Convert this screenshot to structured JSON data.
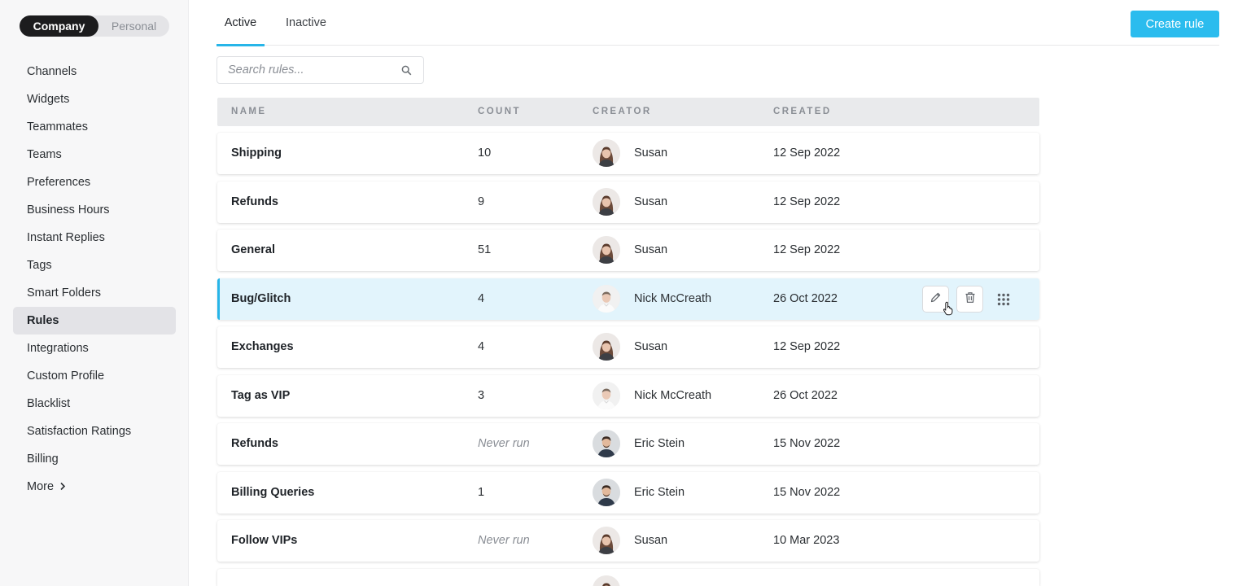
{
  "account_toggle": {
    "company": "Company",
    "personal": "Personal",
    "selected": "Company"
  },
  "sidebar": {
    "items": [
      {
        "label": "Channels"
      },
      {
        "label": "Widgets"
      },
      {
        "label": "Teammates"
      },
      {
        "label": "Teams"
      },
      {
        "label": "Preferences"
      },
      {
        "label": "Business Hours"
      },
      {
        "label": "Instant Replies"
      },
      {
        "label": "Tags"
      },
      {
        "label": "Smart Folders"
      },
      {
        "label": "Rules",
        "active": true
      },
      {
        "label": "Integrations"
      },
      {
        "label": "Custom Profile"
      },
      {
        "label": "Blacklist"
      },
      {
        "label": "Satisfaction Ratings"
      },
      {
        "label": "Billing"
      },
      {
        "label": "More",
        "icon": "chevron-right-icon"
      }
    ]
  },
  "tabs": [
    {
      "label": "Active",
      "active": true
    },
    {
      "label": "Inactive"
    }
  ],
  "create_button": "Create rule",
  "search": {
    "placeholder": "Search rules...",
    "icon": "search-icon"
  },
  "table": {
    "headers": {
      "name": "NAME",
      "count": "COUNT",
      "creator": "CREATOR",
      "created": "CREATED"
    },
    "rows": [
      {
        "name": "Shipping",
        "count": "10",
        "creator": "Susan",
        "created": "12 Sep 2022",
        "avatar": "susan"
      },
      {
        "name": "Refunds",
        "count": "9",
        "creator": "Susan",
        "created": "12 Sep 2022",
        "avatar": "susan"
      },
      {
        "name": "General",
        "count": "51",
        "creator": "Susan",
        "created": "12 Sep 2022",
        "avatar": "susan"
      },
      {
        "name": "Bug/Glitch",
        "count": "4",
        "creator": "Nick McCreath",
        "created": "26 Oct 2022",
        "avatar": "nick",
        "highlighted": true
      },
      {
        "name": "Exchanges",
        "count": "4",
        "creator": "Susan",
        "created": "12 Sep 2022",
        "avatar": "susan"
      },
      {
        "name": "Tag as VIP",
        "count": "3",
        "creator": "Nick McCreath",
        "created": "26 Oct 2022",
        "avatar": "nick"
      },
      {
        "name": "Refunds",
        "count": "Never run",
        "creator": "Eric Stein",
        "created": "15 Nov 2022",
        "avatar": "eric"
      },
      {
        "name": "Billing Queries",
        "count": "1",
        "creator": "Eric Stein",
        "created": "15 Nov 2022",
        "avatar": "eric"
      },
      {
        "name": "Follow VIPs",
        "count": "Never run",
        "creator": "Susan",
        "created": "10 Mar 2023",
        "avatar": "susan"
      },
      {
        "name": "",
        "count": "",
        "creator": "",
        "created": "",
        "avatar": "susan",
        "partial": true
      }
    ],
    "row_actions": [
      "pencil-icon",
      "trash-icon",
      "drag-handle-icon"
    ]
  },
  "colors": {
    "accent": "#2bbcee",
    "highlight_row": "#e2f4fc",
    "toggle_active": "#1c1c1e"
  }
}
